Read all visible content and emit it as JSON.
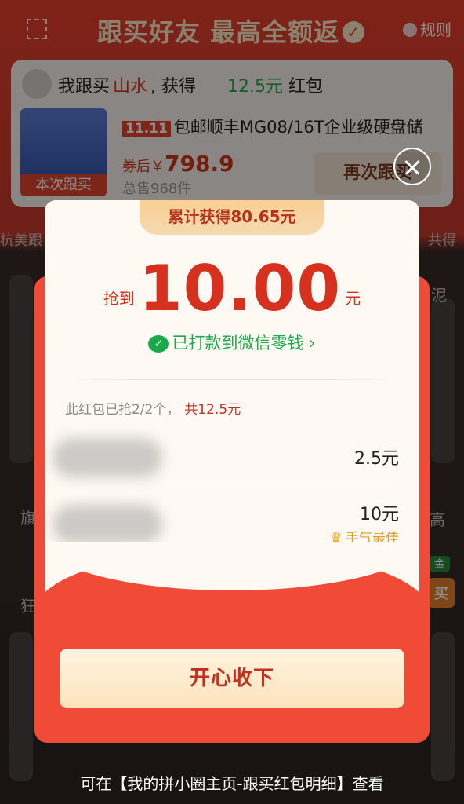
{
  "background": {
    "header_title": "跟买好友 最高全额返",
    "rules_label": "规则",
    "record": {
      "line_prefix": "我跟买",
      "shop": "山水",
      "line_mid": ", 获得",
      "amount": "12.5元",
      "amount_suffix": "红包",
      "thumb_label": "本次跟买",
      "product_tag": "11.11",
      "product_title": "包邮顺丰MG08/16T企业级硬盘储",
      "price_prefix": "券后￥",
      "price": "798.9",
      "sold": "总售968件",
      "again_button": "再次跟买"
    },
    "row2_left": "杭美跟",
    "row2_right": "共得",
    "side_right_1": "泥",
    "side_right_2": "高",
    "side_right_tag": "金",
    "side_right_btn": "买",
    "side_left_1": "旗",
    "side_left_2": "狂"
  },
  "modal": {
    "ribbon": "累计获得80.65元",
    "grab_prefix": "抢到",
    "grab_amount": "10.00",
    "grab_unit": "元",
    "paid_text": "已打款到微信零钱",
    "summary": "此红包已抢2/2个，",
    "summary_total": "共12.5元",
    "rows": [
      {
        "amount": "2.5元",
        "best": ""
      },
      {
        "amount": "10元",
        "best": "手气最佳"
      }
    ],
    "accept_button": "开心收下"
  },
  "hint": "可在【我的拼小圈主页-跟买红包明细】查看"
}
